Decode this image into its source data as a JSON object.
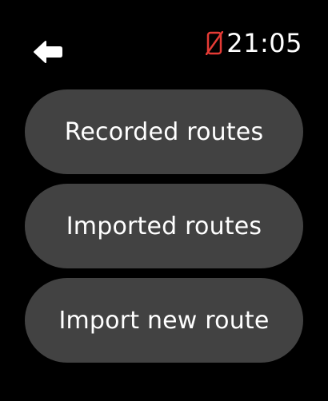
{
  "header": {
    "back_icon": "back-arrow-icon",
    "status_icon": "phone-disconnected-icon",
    "status_icon_color": "#e53b35",
    "time": "21:05"
  },
  "menu": {
    "button_color": "#424242",
    "items": [
      {
        "label": "Recorded routes"
      },
      {
        "label": "Imported routes"
      },
      {
        "label": "Import new route"
      }
    ]
  }
}
